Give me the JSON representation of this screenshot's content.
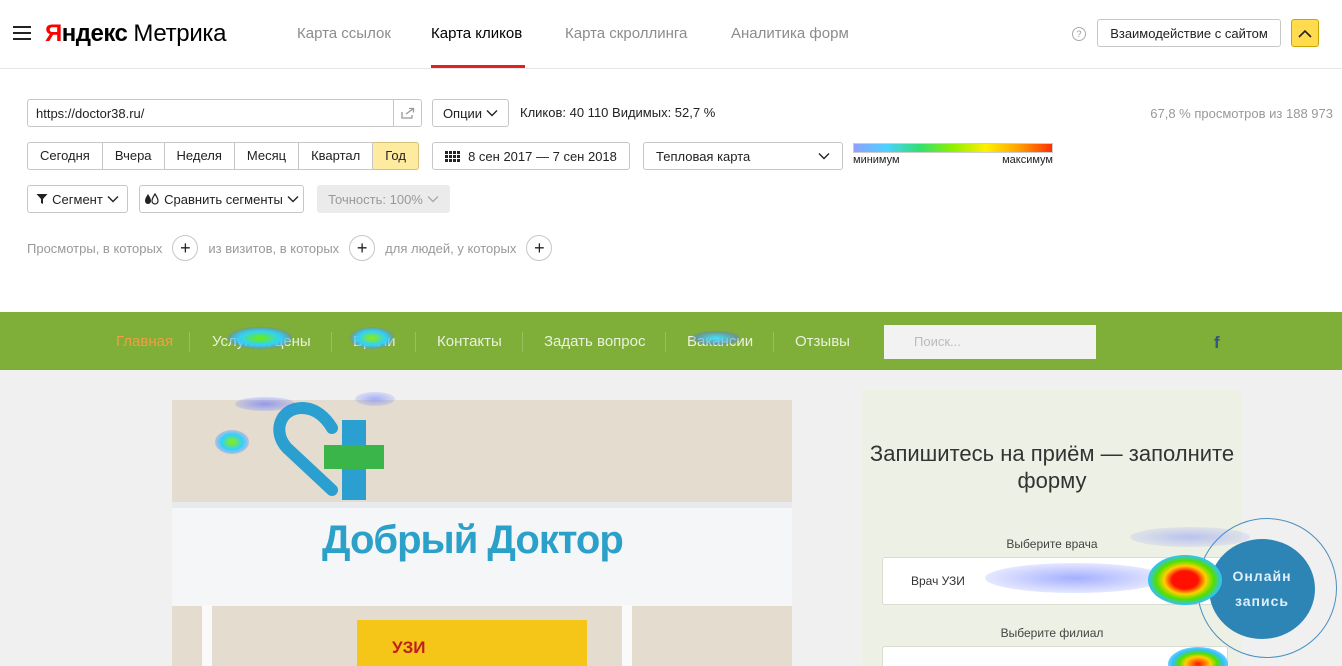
{
  "header": {
    "logo_red": "Я",
    "logo_ndex": "ндекс",
    "logo_product": "Метрика",
    "tabs": [
      "Карта ссылок",
      "Карта кликов",
      "Карта скроллинга",
      "Аналитика форм"
    ],
    "active_tab": "Карта кликов",
    "help_glyph": "?",
    "interact_button": "Взаимодействие с сайтом",
    "collapse_glyph": "⌃"
  },
  "panel": {
    "url_value": "https://doctor38.ru/",
    "share_glyph": "⇗",
    "options_label": "Опции",
    "clicks_text": "Кликов: 40 110  Видимых: 52,7 %",
    "views_text": "67,8 % просмотров из 188 973",
    "periods": [
      "Сегодня",
      "Вчера",
      "Неделя",
      "Месяц",
      "Квартал",
      "Год"
    ],
    "active_period": "Год",
    "date_range": "8 сен 2017 — 7 сен 2018",
    "map_type": "Тепловая карта",
    "legend_min": "минимум",
    "legend_max": "максимум",
    "segment_label": "Сегмент",
    "compare_label": "Сравнить сегменты",
    "accuracy_label": "Точность: 100%",
    "filter_views": "Просмотры, в которых",
    "filter_visits": "из визитов, в которых",
    "filter_people": "для людей, у которых",
    "plus_glyph": "+"
  },
  "site": {
    "menu": [
      "Главная",
      "Услуги и цены",
      "Врачи",
      "Контакты",
      "Задать вопрос",
      "Вакансии",
      "Отзывы"
    ],
    "search_placeholder": "Поиск...",
    "facebook_glyph": "f",
    "photo_sign": "Добрый Доктор",
    "photo_uzi": "УЗИ",
    "form_title": "Запишитесь на приём — заполните форму",
    "doctor_label": "Выберите врача",
    "doctor_value": "Врач УЗИ",
    "branch_label": "Выберите филиал",
    "online_line1": "Онлайн",
    "online_line2": "запись"
  },
  "colors": {
    "accent_red": "#e12222",
    "yandex_yellow": "#ffdb4d",
    "active_period_bg": "#ffeba0",
    "site_menu_green": "#7fae39",
    "online_button_blue": "#2d85b5"
  }
}
